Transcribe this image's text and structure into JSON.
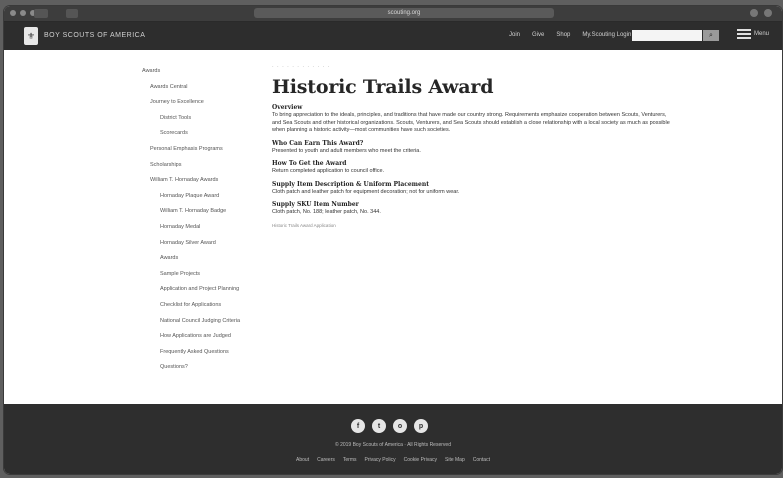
{
  "browser": {
    "url": "scouting.org"
  },
  "header": {
    "brand": "BOY SCOUTS OF AMERICA",
    "nav": [
      "Join",
      "Give",
      "Shop",
      "My.Scouting Login"
    ],
    "search_placeholder": "",
    "menu_label": "Menu"
  },
  "breadcrumb": "· · ·  · · · ·  · · · ·  ·",
  "sidebar": {
    "items": [
      "Awards",
      "Awards Central",
      "Journey to Excellence",
      "District Tools",
      "Scorecards",
      "Personal Emphasis Programs",
      "Scholarships",
      "William T. Hornaday Awards",
      "Hornaday Plaque Award",
      "William T. Hornaday Badge",
      "Hornaday Medal",
      "Hornaday Silver Award",
      "Awards",
      "Sample Projects",
      "Application and Project Planning",
      "Checklist for Applications",
      "National Council Judging Criteria",
      "How Applications are Judged",
      "Frequently Asked Questions",
      "Questions?"
    ]
  },
  "main": {
    "title": "Historic Trails Award",
    "sections": [
      {
        "heading": "Overview",
        "text": "To bring appreciation to the ideals, principles, and traditions that have made our country strong. Requirements emphasize cooperation between Scouts, Venturers, and Sea Scouts and other historical organizations. Scouts, Venturers, and Sea Scouts should establish a close relationship with a local society as much as possible when planning a historic activity—most communities have such societies."
      },
      {
        "heading": "Who Can Earn This Award?",
        "text": "Presented to youth and adult members who meet the criteria."
      },
      {
        "heading": "How To Get the Award",
        "text": "Return completed application to council office."
      },
      {
        "heading": "Supply Item Description & Uniform Placement",
        "text": "Cloth patch and leather patch for equipment decoration; not for uniform wear."
      },
      {
        "heading": "Supply SKU Item Number",
        "text": "Cloth patch, No. 188; leather patch, No. 344."
      }
    ],
    "related": "Historic Trails Award Application"
  },
  "footer": {
    "social": [
      "f",
      "t",
      "o",
      "p"
    ],
    "copyright": "© 2019 Boy Scouts of America · All Rights Reserved",
    "links": [
      "About",
      "Careers",
      "Terms",
      "Privacy Policy",
      "Cookie Privacy",
      "Site Map",
      "Contact"
    ]
  }
}
